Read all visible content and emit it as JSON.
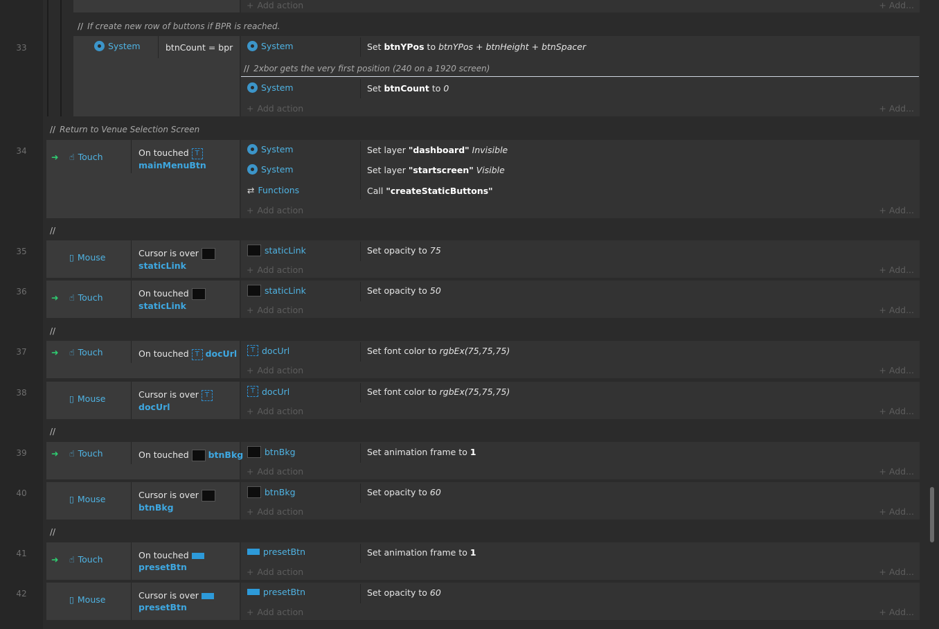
{
  "line_numbers": [
    "33",
    "34",
    "35",
    "36",
    "37",
    "38",
    "39",
    "40",
    "41",
    "42"
  ],
  "add_action": "Add action",
  "add_right": "Add...",
  "comments": {
    "c_bpr": "If create new row of buttons if BPR is reached.",
    "c_2xbor": "2xbor gets the very first position (240 on a 1920 screen)",
    "c_return": "Return to Venue Selection Screen",
    "slash": "//"
  },
  "e33": {
    "trigger": "System",
    "condition": "btnCount = bpr",
    "a1_obj": "System",
    "a1_pre": "Set ",
    "a1_var": "btnYPos",
    "a1_mid": " to ",
    "a1_val": "btnYPos + btnHeight + btnSpacer",
    "a2_obj": "System",
    "a2_pre": "Set ",
    "a2_var": "btnCount",
    "a2_mid": " to ",
    "a2_val": "0"
  },
  "e34": {
    "trigger": "Touch",
    "cond_pre": "On touched",
    "cond_obj": "mainMenuBtn",
    "a1_obj": "System",
    "a1_pre": "Set layer ",
    "a1_name": "\"dashboard\"",
    "a1_val": "Invisible",
    "a2_obj": "System",
    "a2_pre": "Set layer ",
    "a2_name": "\"startscreen\"",
    "a2_val": "Visible",
    "a3_obj": "Functions",
    "a3_pre": "Call ",
    "a3_name": "\"createStaticButtons\""
  },
  "e35": {
    "trigger": "Mouse",
    "cond_pre": "Cursor is over",
    "cond_obj": "staticLink",
    "a_obj": "staticLink",
    "a_pre": "Set opacity to ",
    "a_val": "75"
  },
  "e36": {
    "trigger": "Touch",
    "cond_pre": "On touched",
    "cond_obj": "staticLink",
    "a_obj": "staticLink",
    "a_pre": "Set opacity to ",
    "a_val": "50"
  },
  "e37": {
    "trigger": "Touch",
    "cond_pre": "On touched",
    "cond_obj": "docUrl",
    "a_obj": "docUrl",
    "a_pre": "Set font color to ",
    "a_val": "rgbEx(75,75,75)"
  },
  "e38": {
    "trigger": "Mouse",
    "cond_pre": "Cursor is over",
    "cond_obj": "docUrl",
    "a_obj": "docUrl",
    "a_pre": "Set font color to ",
    "a_val": "rgbEx(75,75,75)"
  },
  "e39": {
    "trigger": "Touch",
    "cond_pre": "On touched",
    "cond_obj": "btnBkg",
    "a_obj": "btnBkg",
    "a_pre": "Set animation frame to ",
    "a_val": "1"
  },
  "e40": {
    "trigger": "Mouse",
    "cond_pre": "Cursor is over",
    "cond_obj": "btnBkg",
    "a_obj": "btnBkg",
    "a_pre": "Set opacity to ",
    "a_val": "60"
  },
  "e41": {
    "trigger": "Touch",
    "cond_pre": "On touched",
    "cond_obj": "presetBtn",
    "a_obj": "presetBtn",
    "a_pre": "Set animation frame to ",
    "a_val": "1"
  },
  "e42": {
    "trigger": "Mouse",
    "cond_pre": "Cursor is over",
    "cond_obj": "presetBtn",
    "a_obj": "presetBtn",
    "a_pre": "Set opacity to ",
    "a_val": "60"
  },
  "colors": {
    "background": "#2b2b2b",
    "object_blue": "#4fb3e3",
    "trigger_arrow": "#2ecc71"
  }
}
